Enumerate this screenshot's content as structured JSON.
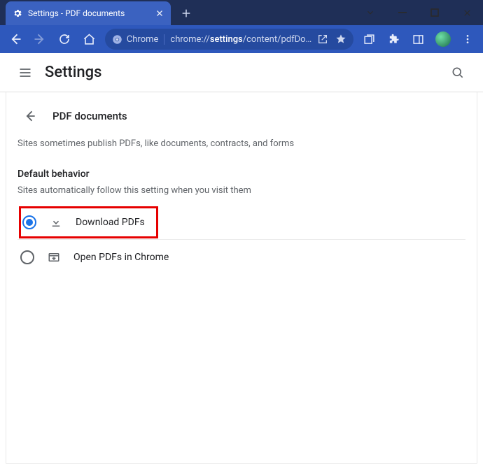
{
  "window": {
    "tab_title": "Settings - PDF documents"
  },
  "omnibox": {
    "chip_label": "Chrome",
    "url_prefix": "chrome://",
    "url_bold": "settings",
    "url_suffix": "/content/pdfDo…"
  },
  "header": {
    "title": "Settings"
  },
  "page": {
    "back_label": "PDF documents",
    "description": "Sites sometimes publish PDFs, like documents, contracts, and forms",
    "section_title": "Default behavior",
    "section_sub": "Sites automatically follow this setting when you visit them",
    "options": [
      {
        "label": "Download PDFs",
        "selected": true
      },
      {
        "label": "Open PDFs in Chrome",
        "selected": false
      }
    ]
  }
}
